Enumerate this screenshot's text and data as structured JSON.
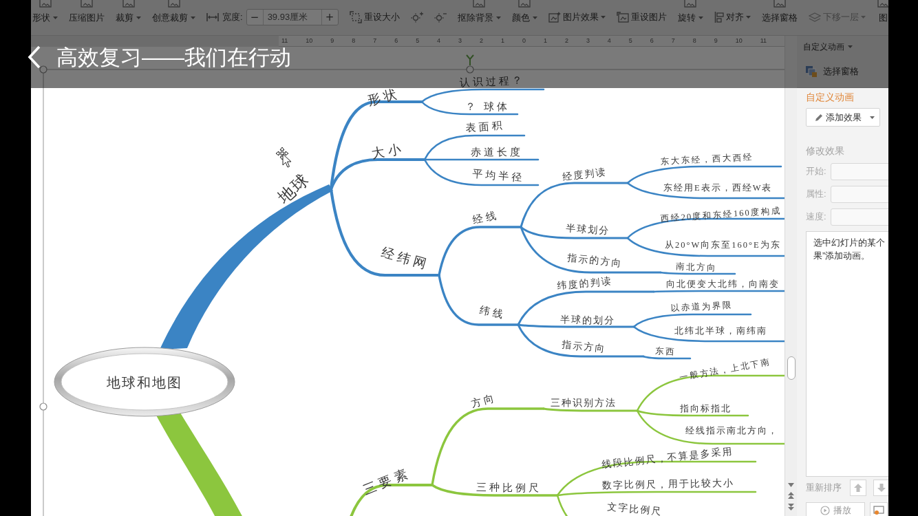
{
  "video": {
    "title": "高效复习——我们在行动"
  },
  "toolbar": [
    {
      "kind": "large",
      "label": "形状",
      "menu": true,
      "disabled": false
    },
    {
      "kind": "large",
      "label": "压缩图片",
      "menu": false,
      "disabled": false
    },
    {
      "kind": "large",
      "label": "裁剪",
      "menu": true,
      "disabled": false
    },
    {
      "kind": "large",
      "label": "创意裁剪",
      "menu": true,
      "disabled": false
    },
    {
      "kind": "stepper",
      "label": "宽度:",
      "minus": "−",
      "value": "39.93厘米",
      "plus": "+",
      "menu": false,
      "disabled": false
    },
    {
      "kind": "resize",
      "label": "重设大小",
      "menu": false,
      "disabled": false
    },
    {
      "kind": "brighter",
      "menu": false,
      "disabled": false
    },
    {
      "kind": "dimmer",
      "menu": false,
      "disabled": false
    },
    {
      "kind": "large",
      "label": "抠除背景",
      "menu": true,
      "disabled": false
    },
    {
      "kind": "large",
      "label": "颜色",
      "menu": true,
      "disabled": false
    },
    {
      "kind": "effects",
      "label": "图片效果",
      "menu": true,
      "disabled": false
    },
    {
      "kind": "reset",
      "label": "重设图片",
      "menu": false,
      "disabled": false
    },
    {
      "kind": "large",
      "label": "旋转",
      "menu": true,
      "disabled": false
    },
    {
      "kind": "align",
      "label": "对齐",
      "menu": true,
      "disabled": false
    },
    {
      "kind": "large",
      "label": "选择窗格",
      "menu": false,
      "disabled": false
    },
    {
      "kind": "layers",
      "label": "下移一层",
      "menu": true,
      "disabled": true
    },
    {
      "kind": "large",
      "label": "图",
      "menu": false,
      "disabled": false
    }
  ],
  "ruler": [
    "11",
    "10",
    "9",
    "8",
    "7",
    "6",
    "5",
    "4",
    "3",
    "2",
    "1",
    "0",
    "1",
    "2",
    "3",
    "4",
    "5",
    "6",
    "7",
    "8",
    "9",
    "10",
    "11"
  ],
  "mind_map": {
    "root": {
      "label": "地球和地图",
      "children": [
        {
          "label": "地球",
          "color": "#3b84c4",
          "children": [
            {
              "label": "形状",
              "children": [
                {
                  "label": "认识过程？"
                },
                {
                  "label": "？ 球体"
                }
              ]
            },
            {
              "label": "大小",
              "children": [
                {
                  "label": "表面积"
                },
                {
                  "label": "赤道长度"
                },
                {
                  "label": "平均半径"
                }
              ]
            },
            {
              "label": "经纬网",
              "children": [
                {
                  "label": "经线",
                  "children": [
                    {
                      "label": "经度判读",
                      "children": [
                        {
                          "label": "东大东经，西大西经"
                        },
                        {
                          "label": "东经用E表示，西经W表"
                        }
                      ]
                    },
                    {
                      "label": "半球划分",
                      "children": [
                        {
                          "label": "西经20度和东经160度构成"
                        },
                        {
                          "label": "从20°W向东至160°E为东"
                        }
                      ]
                    },
                    {
                      "label": "指示的方向",
                      "children": [
                        {
                          "label": "南北方向"
                        }
                      ]
                    }
                  ]
                },
                {
                  "label": "纬线",
                  "children": [
                    {
                      "label": "纬度的判读",
                      "children": [
                        {
                          "label": "向北便变大北纬，向南变"
                        }
                      ]
                    },
                    {
                      "label": "半球的划分",
                      "children": [
                        {
                          "label": "以赤道为界限"
                        },
                        {
                          "label": "北纬北半球，南纬南"
                        }
                      ]
                    },
                    {
                      "label": "指示方向",
                      "children": [
                        {
                          "label": "东西"
                        }
                      ]
                    }
                  ]
                }
              ]
            }
          ]
        },
        {
          "color": "#8cc63e",
          "children": [
            {
              "label": "三要素",
              "children": [
                {
                  "label": "方向",
                  "children": [
                    {
                      "label": "三种识别方法",
                      "children": [
                        {
                          "label": "一般方法，上北下南"
                        },
                        {
                          "label": "指向标指北"
                        },
                        {
                          "label": "经线指示南北方向，"
                        }
                      ]
                    }
                  ]
                },
                {
                  "label": "三种比例尺",
                  "children": [
                    {
                      "label": "线段比例尺，不算是多采用"
                    },
                    {
                      "label": "数字比例尺，用于比较大小"
                    },
                    {
                      "label": "文字比例尺"
                    }
                  ]
                }
              ]
            }
          ]
        }
      ]
    }
  },
  "animation_pane": {
    "header_menu": "自定义动画",
    "selection_pane": "选择窗格",
    "title": "自定义动画",
    "add_effect": "添加效果",
    "section": "修改效果",
    "fields": [
      {
        "label": "开始:",
        "disabled": true
      },
      {
        "label": "属性:",
        "disabled": true
      },
      {
        "label": "速度:",
        "disabled": true
      }
    ],
    "hint_lines": [
      "选中幻灯片的某个",
      "果”添加动画。"
    ],
    "reorder_label": "重新排序",
    "play_button": "播放"
  }
}
